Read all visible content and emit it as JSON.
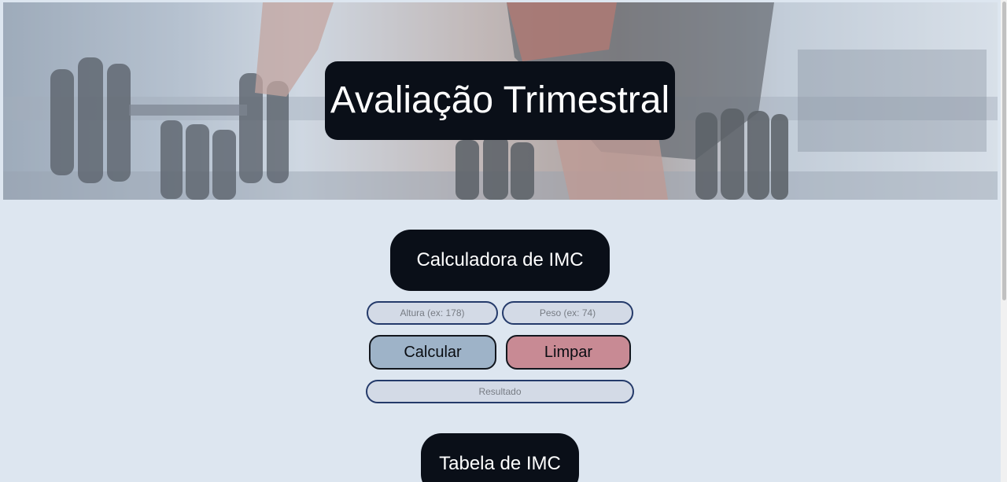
{
  "hero": {
    "title": "Avaliação Trimestral"
  },
  "calculator": {
    "title": "Calculadora de IMC",
    "height_input": {
      "placeholder": "Altura (ex: 178)",
      "value": ""
    },
    "weight_input": {
      "placeholder": "Peso (ex: 74)",
      "value": ""
    },
    "calculate_label": "Calcular",
    "clear_label": "Limpar",
    "result_input": {
      "placeholder": "Resultado",
      "value": ""
    }
  },
  "table_section": {
    "title": "Tabela de IMC"
  },
  "colors": {
    "background": "#dde6f0",
    "dark_box": "#0a0f18",
    "calculate_button": "#9eb3c8",
    "clear_button": "#c88a94",
    "input_border": "#243a6a",
    "input_fill": "#d3dae6"
  },
  "icons": {
    "hero_image": "gym-dumbbells-photo"
  }
}
